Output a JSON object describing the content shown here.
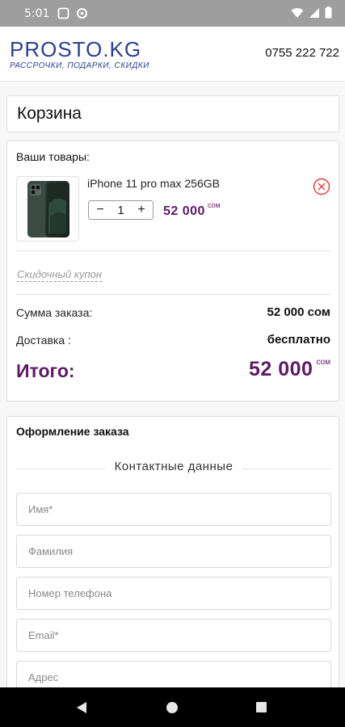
{
  "status_bar": {
    "time": "5:01"
  },
  "header": {
    "logo_main": "PROSTO.KG",
    "logo_sub": "РАССРОЧКИ, ПОДАРКИ, СКИДКИ",
    "phone": "0755 222 722"
  },
  "cart": {
    "title": "Корзина",
    "items_label": "Ваши товары:",
    "items": [
      {
        "name": "iPhone 11 pro max 256GB",
        "quantity": "1",
        "price": "52 000",
        "currency": "сом"
      }
    ],
    "coupon_label": "Скидочный купон",
    "summary": {
      "order_sum_label": "Сумма заказа:",
      "order_sum_value": "52 000 сом",
      "delivery_label": "Доставка :",
      "delivery_value": "бесплатно",
      "total_label": "Итого:",
      "total_value": "52 000",
      "total_currency": "сом"
    }
  },
  "checkout": {
    "title": "Оформление заказа",
    "section_title": "Контактные данные",
    "fields": [
      {
        "placeholder": "Имя*"
      },
      {
        "placeholder": "Фамилия"
      },
      {
        "placeholder": "Номер телефона"
      },
      {
        "placeholder": "Email*"
      },
      {
        "placeholder": "Адрес"
      }
    ]
  },
  "colors": {
    "accent": "#5e1a63",
    "logo": "#2a3f8f",
    "remove": "#e53935",
    "status_bar": "#9e9e9e"
  }
}
